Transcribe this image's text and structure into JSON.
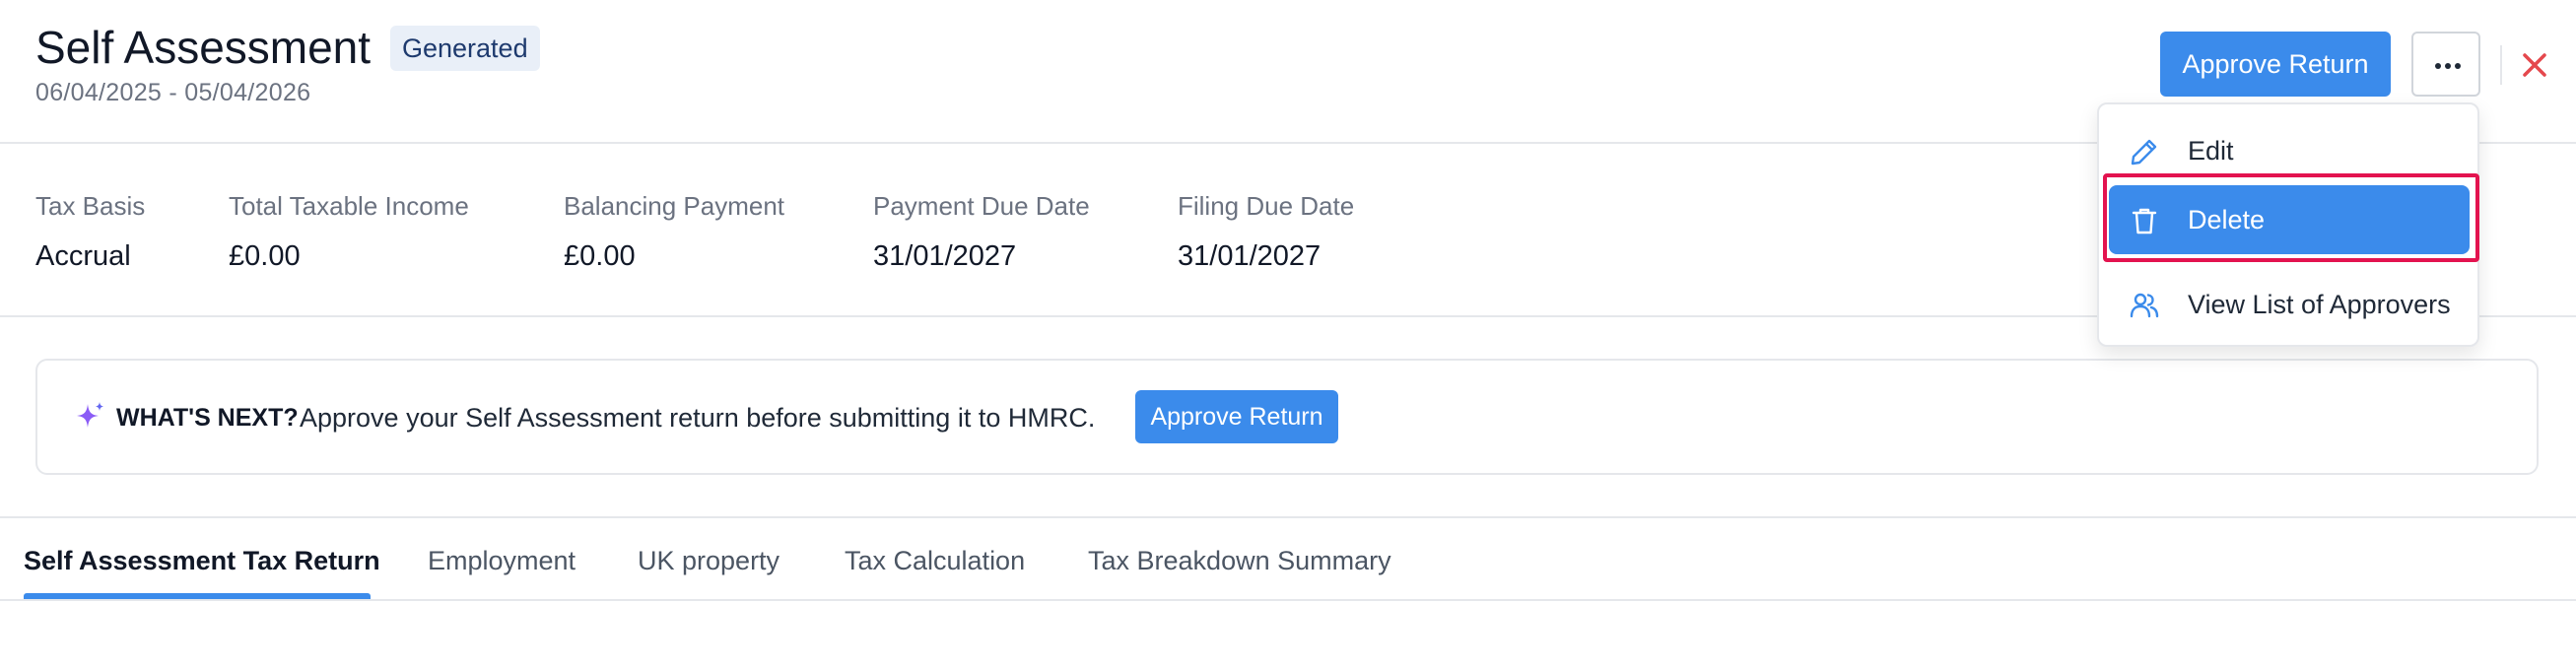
{
  "header": {
    "title": "Self Assessment",
    "status_badge": "Generated",
    "period": "06/04/2025 - 05/04/2026",
    "approve_button": "Approve Return",
    "more_icon": "more-horizontal-icon",
    "close_icon": "close-icon"
  },
  "summary": [
    {
      "label": "Tax Basis",
      "value": "Accrual"
    },
    {
      "label": "Total Taxable Income",
      "value": "£0.00"
    },
    {
      "label": "Balancing Payment",
      "value": "£0.00"
    },
    {
      "label": "Payment Due Date",
      "value": "31/01/2027"
    },
    {
      "label": "Filing Due Date",
      "value": "31/01/2027"
    }
  ],
  "next": {
    "icon": "sparkle-icon",
    "label": "WHAT'S NEXT?",
    "text": "Approve your Self Assessment return before submitting it to HMRC.",
    "button": "Approve Return"
  },
  "tabs": [
    {
      "label": "Self Assessment Tax Return",
      "active": true
    },
    {
      "label": "Employment",
      "active": false
    },
    {
      "label": "UK property",
      "active": false
    },
    {
      "label": "Tax Calculation",
      "active": false
    },
    {
      "label": "Tax Breakdown Summary",
      "active": false
    }
  ],
  "menu": {
    "items": [
      {
        "label": "Edit",
        "icon": "pencil-icon"
      },
      {
        "label": "Delete",
        "icon": "trash-icon",
        "highlighted": true
      },
      {
        "label": "View List of Approvers",
        "icon": "users-icon"
      }
    ]
  },
  "colors": {
    "accent": "#3b8beb",
    "close": "#e5484d",
    "highlight_frame": "#e3134f",
    "sparkle": "#8b5cf6"
  }
}
